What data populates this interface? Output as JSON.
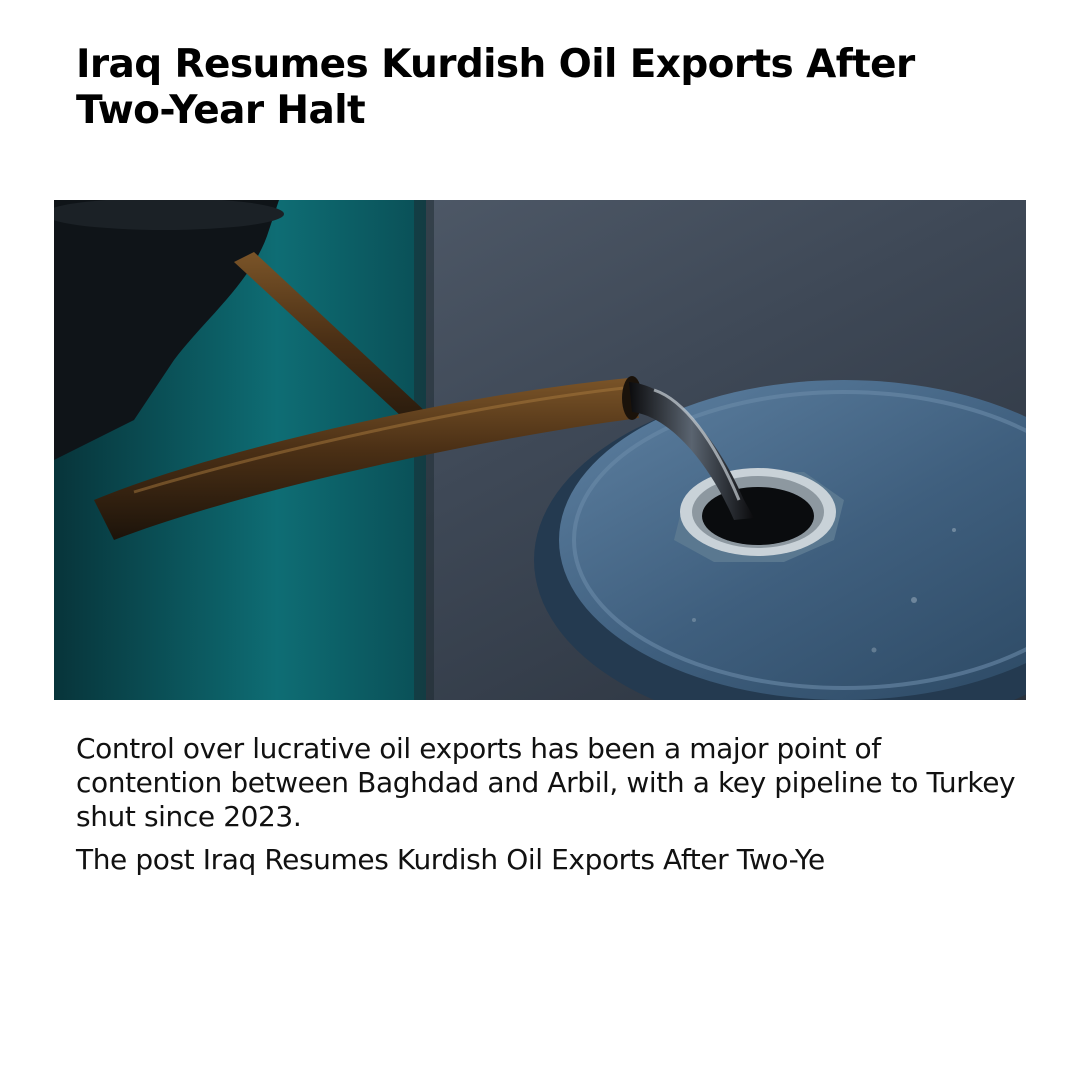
{
  "article": {
    "headline": "Iraq Resumes Kurdish Oil Exports After Two-Year Halt",
    "summary": "Control over lucrative oil exports has been a major point of contention between Baghdad and Arbil, with a key pipeline to Turkey shut since 2023.",
    "excerpt": "The post Iraq Resumes Kurdish Oil Exports After Two-Ye"
  },
  "hero_image": {
    "subject": "oil pouring from a rusty can spout into a blue steel drum"
  },
  "colors": {
    "text": "#111111",
    "background": "#ffffff",
    "teal_backdrop": "#0e6b72",
    "drum_blue": "#4f6f8c",
    "rust": "#5a3a1c"
  }
}
